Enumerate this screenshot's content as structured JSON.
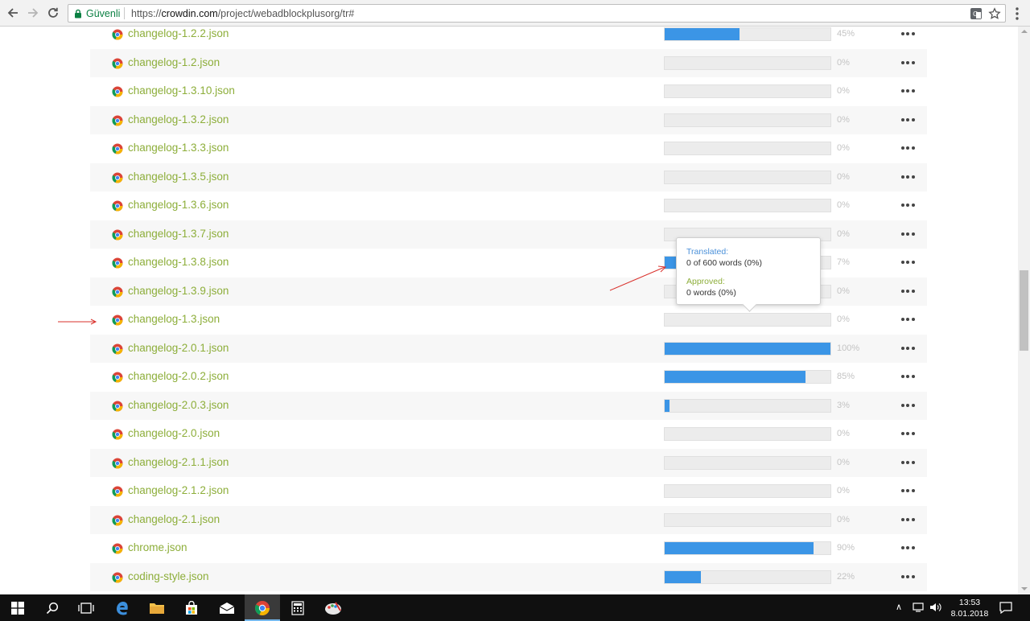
{
  "browser": {
    "security_label": "Güvenli",
    "url_scheme": "https://",
    "url_host": "crowdin.com",
    "url_path": "/project/webadblockplusorg/tr#"
  },
  "files": [
    {
      "name": "changelog-1.2.2.json",
      "percent_label": "45%",
      "progress": 0.45
    },
    {
      "name": "changelog-1.2.json",
      "percent_label": "0%",
      "progress": 0
    },
    {
      "name": "changelog-1.3.10.json",
      "percent_label": "0%",
      "progress": 0
    },
    {
      "name": "changelog-1.3.2.json",
      "percent_label": "0%",
      "progress": 0
    },
    {
      "name": "changelog-1.3.3.json",
      "percent_label": "0%",
      "progress": 0
    },
    {
      "name": "changelog-1.3.5.json",
      "percent_label": "0%",
      "progress": 0
    },
    {
      "name": "changelog-1.3.6.json",
      "percent_label": "0%",
      "progress": 0
    },
    {
      "name": "changelog-1.3.7.json",
      "percent_label": "0%",
      "progress": 0
    },
    {
      "name": "changelog-1.3.8.json",
      "percent_label": "7%",
      "progress": 0.07
    },
    {
      "name": "changelog-1.3.9.json",
      "percent_label": "0%",
      "progress": 0
    },
    {
      "name": "changelog-1.3.json",
      "percent_label": "0%",
      "progress": 0
    },
    {
      "name": "changelog-2.0.1.json",
      "percent_label": "100%",
      "progress": 1.0
    },
    {
      "name": "changelog-2.0.2.json",
      "percent_label": "85%",
      "progress": 0.85
    },
    {
      "name": "changelog-2.0.3.json",
      "percent_label": "3%",
      "progress": 0.03
    },
    {
      "name": "changelog-2.0.json",
      "percent_label": "0%",
      "progress": 0
    },
    {
      "name": "changelog-2.1.1.json",
      "percent_label": "0%",
      "progress": 0
    },
    {
      "name": "changelog-2.1.2.json",
      "percent_label": "0%",
      "progress": 0
    },
    {
      "name": "changelog-2.1.json",
      "percent_label": "0%",
      "progress": 0
    },
    {
      "name": "chrome.json",
      "percent_label": "90%",
      "progress": 0.9
    },
    {
      "name": "coding-style.json",
      "percent_label": "22%",
      "progress": 0.22
    }
  ],
  "tooltip": {
    "translated_label": "Translated:",
    "translated_value": "0 of 600 words (0%)",
    "approved_label": "Approved:",
    "approved_value": "0 words (0%)"
  },
  "colors": {
    "file_link": "#8dae3a",
    "progress_fill": "#3b95e6",
    "translated_label": "#4a90d9",
    "approved_label": "#8dae3a",
    "annotation_arrow": "#d9302b"
  },
  "taskbar": {
    "time": "13:53",
    "date": "8.01.2018",
    "items": [
      "start-icon",
      "search-icon",
      "task-view-icon",
      "edge-icon",
      "file-explorer-icon",
      "store-icon",
      "mail-icon",
      "chrome-icon",
      "calculator-icon",
      "paint-icon"
    ]
  }
}
